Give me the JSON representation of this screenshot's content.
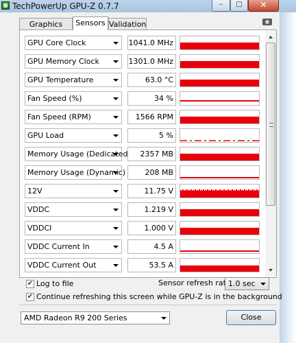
{
  "window": {
    "title": "TechPowerUp GPU-Z 0.7.7",
    "controls": {
      "minimize": "–",
      "maximize": "□",
      "close": "✕"
    }
  },
  "tabs": [
    {
      "label": "Graphics Card",
      "active": false
    },
    {
      "label": "Sensors",
      "active": true
    },
    {
      "label": "Validation",
      "active": false
    }
  ],
  "toolbar": {
    "screenshot_icon": "camera-icon"
  },
  "sensors": [
    {
      "name": "GPU Core Clock",
      "value": "1041.0 MHz",
      "graph_level": 0.55,
      "graph_style": "solid"
    },
    {
      "name": "GPU Memory Clock",
      "value": "1301.0 MHz",
      "graph_level": 0.55,
      "graph_style": "solid"
    },
    {
      "name": "GPU Temperature",
      "value": "63.0 °C",
      "graph_level": 0.55,
      "graph_style": "solid"
    },
    {
      "name": "Fan Speed (%)",
      "value": "34 %",
      "graph_level": 0.3,
      "graph_style": "line"
    },
    {
      "name": "Fan Speed (RPM)",
      "value": "1566 RPM",
      "graph_level": 0.55,
      "graph_style": "solid"
    },
    {
      "name": "GPU Load",
      "value": "5 %",
      "graph_level": 0.1,
      "graph_style": "dashed"
    },
    {
      "name": "Memory Usage (Dedicated)",
      "value": "2357 MB",
      "graph_level": 0.55,
      "graph_style": "solid"
    },
    {
      "name": "Memory Usage (Dynamic)",
      "value": "208 MB",
      "graph_level": 0.1,
      "graph_style": "line"
    },
    {
      "name": "12V",
      "value": "11.75 V",
      "graph_level": 0.55,
      "graph_style": "noisy"
    },
    {
      "name": "VDDC",
      "value": "1.219 V",
      "graph_level": 0.55,
      "graph_style": "solid"
    },
    {
      "name": "VDDCI",
      "value": "1.000 V",
      "graph_level": 0.5,
      "graph_style": "solid"
    },
    {
      "name": "VDDC Current In",
      "value": "4.5 A",
      "graph_level": 0.15,
      "graph_style": "line"
    },
    {
      "name": "VDDC Current Out",
      "value": "53.5 A",
      "graph_level": 0.45,
      "graph_style": "solid"
    }
  ],
  "options": {
    "log_to_file": {
      "label": "Log to file",
      "checked": true
    },
    "continue_refresh": {
      "label": "Continue refreshing this screen while GPU-Z is in the background",
      "checked": true
    },
    "refresh_rate_label": "Sensor refresh rate:",
    "refresh_rate_value": "1.0 sec"
  },
  "footer": {
    "card_name": "AMD Radeon R9 200 Series",
    "close_label": "Close"
  },
  "colors": {
    "graph": "#e8000b",
    "titlebar": "#bcd3ea",
    "window_bg": "#f0f0f0"
  }
}
